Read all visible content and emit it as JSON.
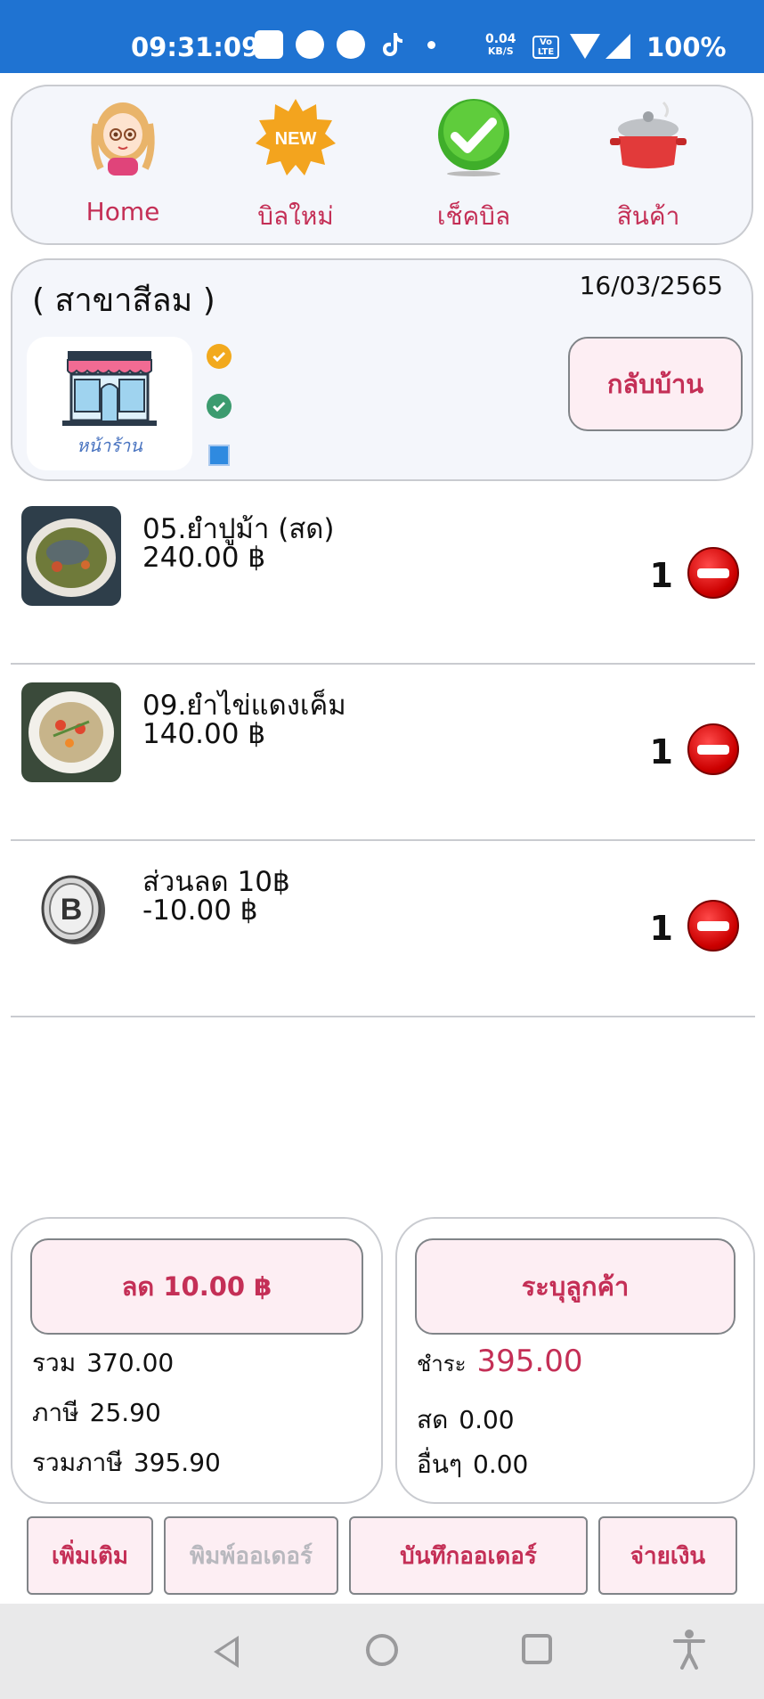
{
  "status_bar": {
    "time": "09:31:09",
    "net_speed_value": "0.04",
    "net_speed_unit": "KB/S",
    "lte_label": "Vo LTE",
    "battery": "100%"
  },
  "nav": {
    "items": [
      {
        "label": "Home",
        "icon": "anime-girl-icon"
      },
      {
        "label": "บิลใหม่",
        "icon": "new-badge-icon"
      },
      {
        "label": "เช็คบิล",
        "icon": "checkmark-icon"
      },
      {
        "label": "สินค้า",
        "icon": "cooking-pot-icon"
      }
    ]
  },
  "branch": {
    "name": "( สาขาสีลม )",
    "date": "16/03/2565",
    "shop_label": "หน้าร้าน",
    "home_button": "กลับบ้าน"
  },
  "order_items": [
    {
      "name": "05.ยำปูม้า (สด)",
      "price": "240.00 ฿",
      "qty": "1",
      "thumb": "crab-salad-photo"
    },
    {
      "name": "09.ยำไข่แดงเค็ม",
      "price": "140.00 ฿",
      "qty": "1",
      "thumb": "salted-egg-salad-photo"
    },
    {
      "name": "ส่วนลด 10฿",
      "price": "-10.00 ฿",
      "qty": "1",
      "thumb": "coin-icon"
    }
  ],
  "summary_left": {
    "discount_button": "ลด 10.00 ฿",
    "total_label": "รวม",
    "total_value": "370.00",
    "tax_label": "ภาษี",
    "tax_value": "25.90",
    "total_tax_label": "รวมภาษี",
    "total_tax_value": "395.90"
  },
  "summary_right": {
    "customer_button": "ระบุลูกค้า",
    "pay_label": "ชำระ",
    "pay_value": "395.00",
    "cash_label": "สด",
    "cash_value": "0.00",
    "other_label": "อื่นๆ",
    "other_value": "0.00"
  },
  "actions": {
    "add_more": "เพิ่มเติม",
    "print_order": "พิมพ์ออเดอร์",
    "save_order": "บันทึกออเดอร์",
    "pay": "จ่ายเงิน"
  },
  "colors": {
    "accent": "#c42f56",
    "status_bar": "#1f73d2",
    "button_bg": "#fdeef3"
  }
}
